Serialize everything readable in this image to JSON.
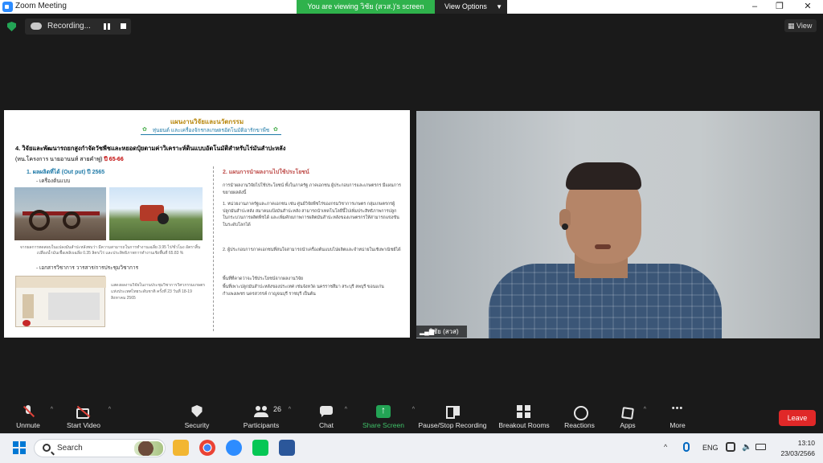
{
  "window": {
    "title": "Zoom Meeting",
    "controls": [
      "–",
      "❐",
      "✕"
    ]
  },
  "banner": {
    "viewing_text": "You are viewing วิชัย (สวส.)'s screen",
    "view_options_label": "View Options"
  },
  "recording": {
    "status_text": "Recording...",
    "pause_icon": "pause-icon",
    "stop_icon": "stop-icon"
  },
  "view_button_label": "View",
  "slide": {
    "heading": "แผนงานวิจัยและนวัตกรรม",
    "subheading": "หุ่นยนต์ และเครื่องจักรกลเกษตรอัตโนมัติอารักขาพืช",
    "project_title": "4. วิจัยและพัฒนารถยกสูงกำจัดวัชพืชและหยอดปุ๋ยตามค่าวิเคราะห์ดินแบบอัตโนมัติสำหรับไร่มันสำปะหลัง",
    "project_leader": "(หน.โครงการ นายอานนท์  สายคำฟู)",
    "project_period": "ปี 65-66",
    "section1_title": "1. ผลผลิตที่ได้ (Out put) ปี 2565",
    "section1_item1": "- เครื่องต้นแบบ",
    "caption1": "จากผลการทดสอบในแปลงมันสำปะหลังพบว่า มีความสามารถในการทำงานเฉลี่ย 3.95 ไร่/ชั่วโมง อัตราสิ้นเปลืองน้ำมันเชื้อเพลิงเฉลี่ย 0.35 ลิตร/ไร่ และประสิทธิภาพการทำงานเชิงพื้นที่ 65.83 %",
    "section1_item2": "- เอกสารวิชาการ วารสาร/การประชุมวิชาการ",
    "caption2": "แสดงผลงานวิจัยในงานประชุมวิชาการวิศวกรรมเกษตรแห่งประเทศไทยระดับชาติ ครั้งที่ 23 วันที่ 18-19 สิงหาคม 2565",
    "section2_title": "2. แผนการนำผลงานไปใช้ประโยชน์",
    "section2_p1": "การนำผลงานวิจัยไปใช้ประโยชน์ ทั้งในภาครัฐ ภาคเอกชน ผู้ประกอบการและเกษตรกร มีแผนการขยายผลดังนี้",
    "section2_p2": "1. หน่วยงานภาครัฐและภาคเอกชน เช่น ศูนย์วิจัยพืชไร่ของกรมวิชาการเกษตร กลุ่มเกษตรกรผู้ปลูกมันสำปะหลัง สมาคมแป้งมันสำปะหลัง สามารถนำเทคโนโลยีนี้ไปเพิ่มประสิทธิภาพการปลูกในกระบวนการผลิตพืชได้ และเพิ่มศักยภาพการผลิตมันสำปะหลังของเกษตรกรให้สามารถแข่งขันในระดับโลกได้",
    "section2_p3": "2. ผู้ประกอบการภาคเอกชนที่สนใจสามารถนำเครื่องต้นแบบไปผลิตและจำหน่ายในเชิงพาณิชย์ได้",
    "section2_p4": "พื้นที่ที่คาดว่าจะใช้ประโยชน์จากผลงานวิจัย",
    "section2_p5": "พื้นที่เพาะปลูกมันสำปะหลังของประเทศ เช่นจังหวัด นครราชสีมา สระบุรี ลพบุรี ขอนแก่น กำแพงเพชร นครสวรรค์ กาญจนบุรี ราชบุรี เป็นต้น"
  },
  "participant": {
    "name": "วิชัย (สวส)"
  },
  "toolbar": {
    "unmute": "Unmute",
    "start_video": "Start Video",
    "security": "Security",
    "participants": "Participants",
    "participants_count": "26",
    "chat": "Chat",
    "share_screen": "Share Screen",
    "pause_stop_recording": "Pause/Stop Recording",
    "breakout_rooms": "Breakout Rooms",
    "reactions": "Reactions",
    "apps": "Apps",
    "more": "More",
    "leave": "Leave"
  },
  "taskbar": {
    "search_placeholder": "Search",
    "language": "ENG",
    "time": "13:10",
    "date": "23/03/2566"
  },
  "colors": {
    "banner_green": "#2fb24c",
    "share_green": "#23a455",
    "leave_red": "#e02828",
    "slide_heading": "#b8860b",
    "slide_blue": "#1f7aa8",
    "slide_red": "#c00000"
  }
}
